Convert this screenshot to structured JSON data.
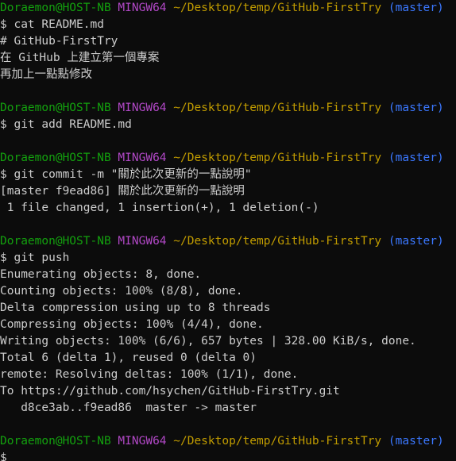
{
  "colors": {
    "background": "#0c0c0c",
    "text": "#cccccc",
    "user": "#13a10e",
    "system": "#b148c6",
    "path": "#c19c00",
    "branch": "#3b78ff"
  },
  "prompt": {
    "user_host": "Doraemon@HOST-NB",
    "system": "MINGW64",
    "path": "~/Desktop/temp/GitHub-FirstTry",
    "branch": "(master)"
  },
  "lines": [
    {
      "type": "prompt"
    },
    {
      "type": "text",
      "text": "$ cat README.md"
    },
    {
      "type": "text",
      "text": "# GitHub-FirstTry"
    },
    {
      "type": "text",
      "text": "在 GitHub 上建立第一個專案"
    },
    {
      "type": "text",
      "text": "再加上一點點修改"
    },
    {
      "type": "blank",
      "text": ""
    },
    {
      "type": "prompt"
    },
    {
      "type": "text",
      "text": "$ git add README.md"
    },
    {
      "type": "blank",
      "text": ""
    },
    {
      "type": "prompt"
    },
    {
      "type": "text",
      "text": "$ git commit -m \"關於此次更新的一點說明\""
    },
    {
      "type": "text",
      "text": "[master f9ead86] 關於此次更新的一點說明"
    },
    {
      "type": "text",
      "text": " 1 file changed, 1 insertion(+), 1 deletion(-)"
    },
    {
      "type": "blank",
      "text": ""
    },
    {
      "type": "prompt"
    },
    {
      "type": "text",
      "text": "$ git push"
    },
    {
      "type": "text",
      "text": "Enumerating objects: 8, done."
    },
    {
      "type": "text",
      "text": "Counting objects: 100% (8/8), done."
    },
    {
      "type": "text",
      "text": "Delta compression using up to 8 threads"
    },
    {
      "type": "text",
      "text": "Compressing objects: 100% (4/4), done."
    },
    {
      "type": "text",
      "text": "Writing objects: 100% (6/6), 657 bytes | 328.00 KiB/s, done."
    },
    {
      "type": "text",
      "text": "Total 6 (delta 1), reused 0 (delta 0)"
    },
    {
      "type": "text",
      "text": "remote: Resolving deltas: 100% (1/1), done."
    },
    {
      "type": "text",
      "text": "To https://github.com/hsychen/GitHub-FirstTry.git"
    },
    {
      "type": "text",
      "text": "   d8ce3ab..f9ead86  master -> master"
    },
    {
      "type": "blank",
      "text": ""
    },
    {
      "type": "prompt"
    },
    {
      "type": "input",
      "text": "$ "
    }
  ]
}
